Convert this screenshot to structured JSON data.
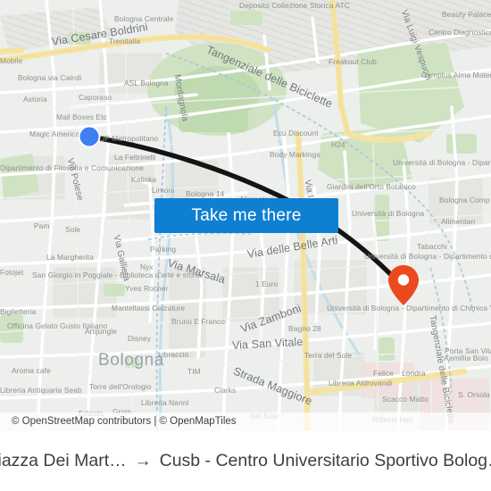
{
  "map": {
    "attribution": "© OpenStreetMap contributors | © OpenMapTiles",
    "city_label": "Bologna",
    "origin_marker_name": "origin-dot",
    "destination_marker_name": "destination-pin",
    "colors": {
      "accent_blue": "#0f7fd1",
      "origin_dot": "#3f7ff0",
      "destination_pin": "#ea4a1e",
      "route_line": "#1a1a1a",
      "land": "#eceeeb",
      "park": "#cfe3c3",
      "road_major": "#f8e6a8",
      "road_minor": "#ffffff",
      "water": "#b9dced",
      "building": "#e4e5e1",
      "label_text": "#8a8d88"
    },
    "streets": [
      "Via Cesare Boldrini",
      "Tangenziale delle Biciclette",
      "Via Polese",
      "Via Galliera",
      "Via Marsala",
      "Via delle Belle Arti",
      "Via Zamboni",
      "Via San Vitale",
      "Strada Maggiore",
      "Via Luigi Vespucci",
      "Montagnola",
      "Tangenziale delle Biciclette",
      "Via Irnerio"
    ],
    "pois": [
      "Bologna Centrale",
      "Deposito Collezione Storica ATC",
      "Trenitalia",
      "Mobile",
      "Bologna via Cairoli",
      "ASL Bologna",
      "Caporaso",
      "Astoria",
      "Mail Boxes Etc",
      "Magic America",
      "JP Metropolitano",
      "La Feltrinelli",
      "Kalinka",
      "Limoni",
      "Bologna 14",
      "Alimentari",
      "Ecu Discount",
      "Body Markings",
      "H24",
      "Freakout Club",
      "Beauty Palace",
      "Centro Diagnostico Cavour",
      "Camplus Alma Mater",
      "Giardini dell'Orto Botanico",
      "Università di Bologna",
      "Università di Bologna - Dipartimento di Fisica",
      "Bologna Comp",
      "Alimentari",
      "Tabacchi",
      "Università di Bologna - Dipartimento di Informatica",
      "Università di Bologna - Dipartimento di Chimica \"G. Ciamician\"",
      "Dipartimento di Filosofia e Comunicazione",
      "Pam",
      "Sole",
      "La Margherita",
      "Fotojet",
      "San Giorgio in Poggiale - Biblioteca d'arte e storia",
      "Biglietteria",
      "Officina Gelato Gusto Italiano",
      "Artijungle",
      "Aroma cafe",
      "Libreria Antiquaria Seab",
      "Torre dell'Orologio",
      "Edicola",
      "Grom",
      "Libreria Nanni",
      "Clarks",
      "TIM",
      "Libraccio",
      "Bruno E Franco",
      "Nyx",
      "Yves Rocher",
      "Mantellassi Calzature",
      "Disney",
      "Parking",
      "1 Euro",
      "Bagno 28",
      "Terra del Sole",
      "Libreria Aldrovandi",
      "Felice",
      "Londra",
      "Scacco Matto",
      "Riflessi Hair",
      "Porta San Vitale",
      "Aemillia Bolo",
      "S. Orsola",
      "Del Sole"
    ]
  },
  "cta": {
    "label": "Take me there"
  },
  "caption": {
    "origin": "Piazza Dei Mart…",
    "arrow": "→",
    "destination": "Cusb - Centro Universitario Sportivo Bolog…"
  }
}
